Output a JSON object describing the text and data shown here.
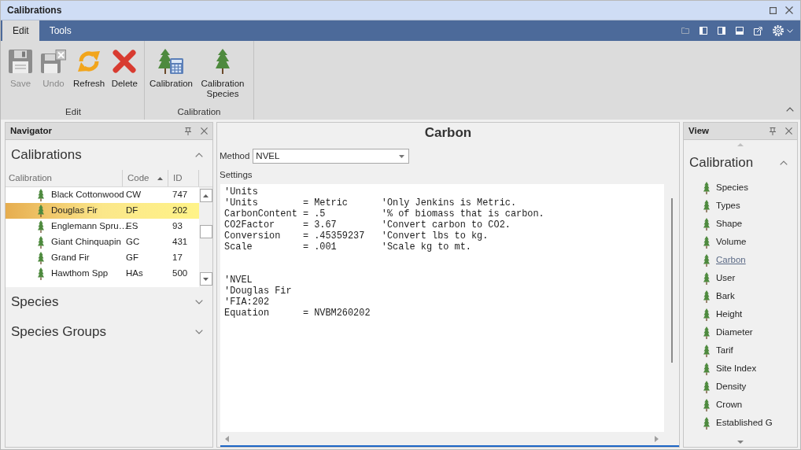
{
  "window": {
    "title": "Calibrations"
  },
  "ribbon": {
    "tabs": [
      {
        "label": "Edit",
        "selected": true
      },
      {
        "label": "Tools",
        "selected": false
      }
    ],
    "groups": [
      {
        "label": "Edit",
        "buttons": [
          {
            "label": "Save",
            "kind": "save",
            "disabled": true
          },
          {
            "label": "Undo",
            "kind": "undo",
            "disabled": true
          },
          {
            "label": "Refresh",
            "kind": "refresh",
            "disabled": false
          },
          {
            "label": "Delete",
            "kind": "delete",
            "disabled": false
          }
        ]
      },
      {
        "label": "Calibration",
        "buttons": [
          {
            "label": "Calibration",
            "kind": "calculator",
            "disabled": false
          },
          {
            "label": "Calibration Species",
            "kind": "tree",
            "disabled": false
          }
        ]
      }
    ]
  },
  "navigator": {
    "title": "Navigator",
    "sections": [
      {
        "title": "Calibrations",
        "expanded": true,
        "table": {
          "columns": [
            {
              "label": "Calibration",
              "sorted": false
            },
            {
              "label": "Code",
              "sorted": true
            },
            {
              "label": "ID",
              "sorted": false
            }
          ],
          "rows": [
            {
              "cells": [
                "Black Cottonwood",
                "CW",
                "747"
              ],
              "selected": false
            },
            {
              "cells": [
                "Douglas Fir",
                "DF",
                "202"
              ],
              "selected": true
            },
            {
              "cells": [
                "Englemann Spru…",
                "ES",
                "93"
              ],
              "selected": false
            },
            {
              "cells": [
                "Giant Chinquapin",
                "GC",
                "431"
              ],
              "selected": false
            },
            {
              "cells": [
                "Grand Fir",
                "GF",
                "17"
              ],
              "selected": false
            },
            {
              "cells": [
                "Hawthom Spp",
                "HAs",
                "500"
              ],
              "selected": false
            }
          ]
        }
      },
      {
        "title": "Species",
        "expanded": false
      },
      {
        "title": "Species Groups",
        "expanded": false
      }
    ]
  },
  "editor": {
    "title": "Carbon",
    "method": {
      "label": "Method",
      "value": "NVEL"
    },
    "settings_label": "Settings",
    "blocks": [
      [
        "'Units",
        "'Units        = Metric      'Only Jenkins is Metric.",
        "CarbonContent = .5          '% of biomass that is carbon.",
        "CO2Factor     = 3.67        'Convert carbon to CO2.",
        "Conversion    = .45359237   'Convert lbs to kg.",
        "Scale         = .001        'Scale kg to mt."
      ],
      [
        "'NVEL",
        "'Douglas Fir",
        "'FIA:202",
        "Equation      = NVBM260202"
      ]
    ]
  },
  "view": {
    "title": "View",
    "section": {
      "title": "Calibration",
      "expanded": true,
      "items": [
        {
          "label": "Species",
          "selected": false
        },
        {
          "label": "Types",
          "selected": false
        },
        {
          "label": "Shape",
          "selected": false
        },
        {
          "label": "Volume",
          "selected": false
        },
        {
          "label": "Carbon",
          "selected": true
        },
        {
          "label": "User",
          "selected": false
        },
        {
          "label": "Bark",
          "selected": false
        },
        {
          "label": "Height",
          "selected": false
        },
        {
          "label": "Diameter",
          "selected": false
        },
        {
          "label": "Tarif",
          "selected": false
        },
        {
          "label": "Site Index",
          "selected": false
        },
        {
          "label": "Density",
          "selected": false
        },
        {
          "label": "Crown",
          "selected": false
        },
        {
          "label": "Established G",
          "selected": false
        }
      ]
    }
  }
}
